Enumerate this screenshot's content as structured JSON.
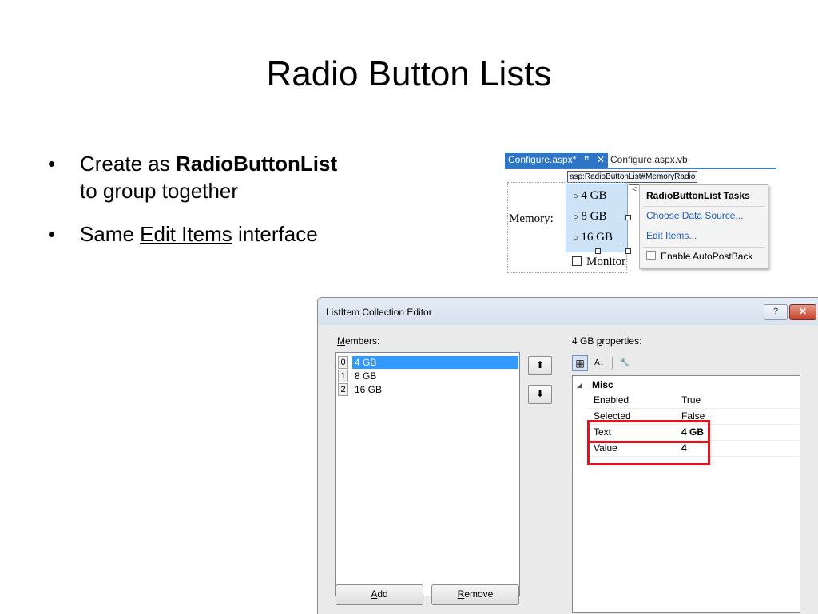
{
  "slide": {
    "title": "Radio Button Lists",
    "bullet_char": "•",
    "bullets": [
      {
        "prefix": "Create as ",
        "bold": "RadioButtonList",
        "suffix": "to group together"
      },
      {
        "prefix": "Same ",
        "underline": "Edit Items",
        "suffix": " interface"
      }
    ]
  },
  "designer": {
    "tabs": [
      "Configure.aspx*",
      "Configure.aspx.vb"
    ],
    "tab_pin_glyph": "ꟸ",
    "tab_close_glyph": "✕",
    "control_tag": "asp:RadioButtonList#MemoryRadio",
    "memory_label": "Memory:",
    "radio_glyph": "○",
    "radio_items": [
      "4 GB",
      "8 GB",
      "16 GB"
    ],
    "checkbox_label": "Monitor",
    "smart_tag_glyph": "<",
    "tasks": {
      "title": "RadioButtonList Tasks",
      "links": [
        "Choose Data Source...",
        "Edit Items..."
      ],
      "checkbox_label": "Enable AutoPostBack"
    }
  },
  "dialog": {
    "title": "ListItem Collection Editor",
    "help_glyph": "?",
    "close_glyph": "✕",
    "members_label_accel": "M",
    "members_label_rest": "embers:",
    "members": [
      {
        "index": "0",
        "text": "4 GB",
        "selected": true
      },
      {
        "index": "1",
        "text": "8 GB",
        "selected": false
      },
      {
        "index": "2",
        "text": "16 GB",
        "selected": false
      }
    ],
    "move_up_glyph": "⬆",
    "move_down_glyph": "⬇",
    "add_accel": "A",
    "add_rest": "dd",
    "remove_accel": "R",
    "remove_rest": "emove",
    "props_label_prefix": "4 GB ",
    "props_label_accel": "p",
    "props_label_rest": "roperties:",
    "toolbar": {
      "categorized_glyph": "▦",
      "alphabetical_glyph": "A↓",
      "property_pages_glyph": "🔧"
    },
    "category_glyph": "◢",
    "category": "Misc",
    "properties": [
      {
        "name": "Enabled",
        "value": "True"
      },
      {
        "name": "Selected",
        "value": "False"
      },
      {
        "name": "Text",
        "value": "4 GB"
      },
      {
        "name": "Value",
        "value": "4"
      }
    ]
  },
  "colors": {
    "accent": "#2e75c5",
    "selection": "#3399ff",
    "highlight": "#e0141e"
  }
}
